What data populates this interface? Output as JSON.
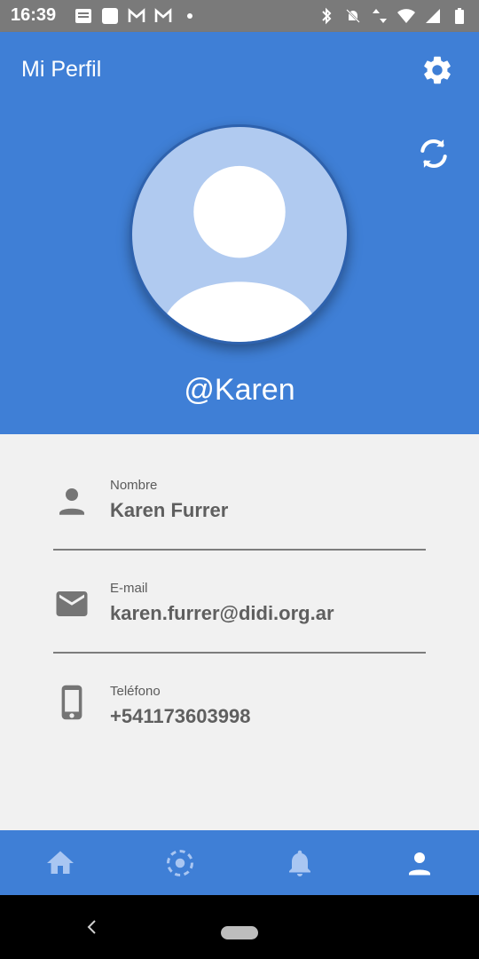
{
  "status_bar": {
    "time": "16:39",
    "left_icons": [
      "notes-icon",
      "square-icon",
      "gmail-icon",
      "gmail-icon",
      "dot-icon"
    ],
    "right_icons": [
      "bluetooth-icon",
      "do-not-disturb-icon",
      "data-arrows-icon",
      "wifi-icon",
      "signal-icon",
      "battery-icon"
    ]
  },
  "app_bar": {
    "title": "Mi Perfil",
    "settings_icon": "gear-icon"
  },
  "profile": {
    "username": "@Karen",
    "refresh_icon": "sync-icon",
    "avatar_icon": "person-avatar-icon"
  },
  "fields": [
    {
      "label": "Nombre",
      "value": "Karen Furrer",
      "icon": "person-icon"
    },
    {
      "label": "E-mail",
      "value": "karen.furrer@didi.org.ar",
      "icon": "email-icon"
    },
    {
      "label": "Teléfono",
      "value": "+541173603998",
      "icon": "phone-icon"
    }
  ],
  "bottom_nav": [
    "home-icon",
    "target-icon",
    "bell-icon",
    "person-icon"
  ],
  "colors": {
    "primary": "#3f7fd6",
    "background": "#f1f1f1",
    "avatar_bg": "#b0caf0",
    "text": "#5f5f5f"
  }
}
